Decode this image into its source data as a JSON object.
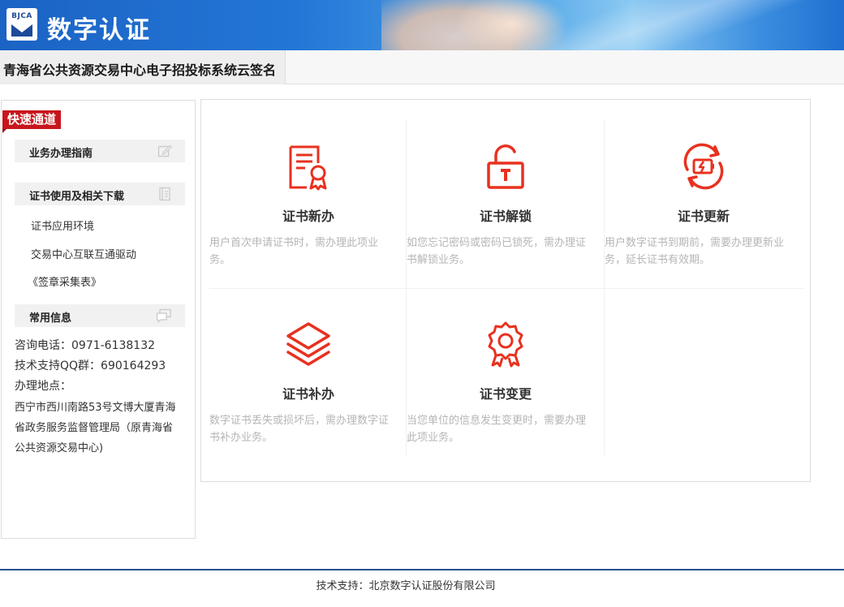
{
  "header": {
    "logo_text": "BJCA",
    "brand_title": "数字认证"
  },
  "system": {
    "title": "青海省公共资源交易中心电子招投标系统云签名"
  },
  "sidebar": {
    "quick_tag": "快速通道",
    "sections": [
      {
        "label": "业务办理指南",
        "icon": "edit-icon"
      },
      {
        "label": "证书使用及相关下载",
        "icon": "document-icon"
      },
      {
        "label": "常用信息",
        "icon": "chat-icon"
      }
    ],
    "links": [
      "证书应用环境",
      "交易中心互联互通驱动",
      "《签章采集表》"
    ],
    "info": {
      "phone": "咨询电话：0971-6138132",
      "qq": "技术支持QQ群：690164293",
      "address_label": "办理地点：",
      "address_line1": "西宁市西川南路53号文博大厦青海",
      "address_line2": "省政务服务监督管理局（原青海省",
      "address_line3": "公共资源交易中心)"
    }
  },
  "services": [
    {
      "title": "证书新办",
      "icon": "certificate-new-icon",
      "desc_line1": "用户首次申请证书时，需办理此项业",
      "desc_line2": "务。"
    },
    {
      "title": "证书解锁",
      "icon": "unlock-icon",
      "desc_line1": "如您忘记密码或密码已锁死，需办理证",
      "desc_line2": "书解锁业务。"
    },
    {
      "title": "证书更新",
      "icon": "renew-icon",
      "desc_line1": "用户数字证书到期前，需要办理更新业",
      "desc_line2": "务，延长证书有效期。"
    },
    {
      "title": "证书补办",
      "icon": "layers-icon",
      "desc_line1": "数字证书丢失或损坏后，需办理数字证",
      "desc_line2": "书补办业务。"
    },
    {
      "title": "证书变更",
      "icon": "badge-icon",
      "desc_line1": "当您单位的信息发生变更时，需要办理",
      "desc_line2": "此项业务。"
    }
  ],
  "footer": {
    "text": "技术支持：北京数字认证股份有限公司"
  },
  "colors": {
    "accent": "#e8311f",
    "quick_tag": "#c8161d",
    "banner": "#2376d6"
  }
}
